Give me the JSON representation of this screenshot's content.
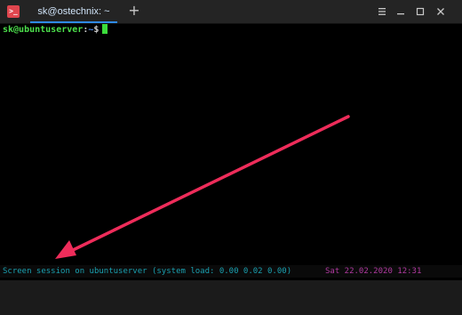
{
  "window": {
    "app_icon_glyph": ">_",
    "tab_title": "sk@ostechnix: ~",
    "new_tab_glyph": "+",
    "accent_color": "#2f8ae8"
  },
  "terminal": {
    "prompt_user": "sk@ubuntuserver",
    "prompt_sep": ":",
    "prompt_path": "~",
    "prompt_symbol": "$"
  },
  "status": {
    "left_text": "Screen session on ubuntuserver (system load: 0.00 0.02 0.00)",
    "right_text": "Sat 22.02.2020 12:31"
  },
  "colors": {
    "terminal_bg": "#000000",
    "prompt_user": "#4ce04c",
    "prompt_path": "#4f8df0",
    "status_left": "#1aa0b0",
    "status_right": "#b03aa0",
    "arrow": "#ee2c5a"
  },
  "icons": [
    "terminal-app-icon",
    "new-tab-icon",
    "menu-icon",
    "minimize-icon",
    "maximize-icon",
    "close-icon",
    "annotation-arrow-icon"
  ]
}
